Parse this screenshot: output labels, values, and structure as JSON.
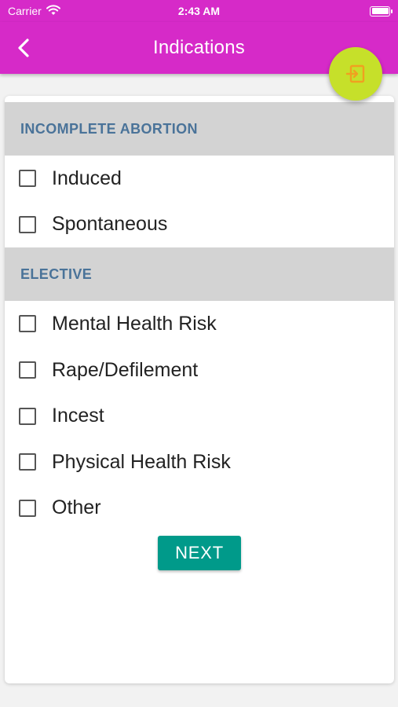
{
  "status_bar": {
    "carrier": "Carrier",
    "time": "2:43 AM",
    "icons": [
      "wifi-icon",
      "battery-icon"
    ]
  },
  "app_bar": {
    "title": "Indications",
    "back_icon": "chevron-left-icon",
    "color": "#d62ac8"
  },
  "fab": {
    "icon": "exit-to-app-icon",
    "color": "#c6e02a",
    "icon_color": "#f0a020"
  },
  "sections": [
    {
      "title": "INCOMPLETE ABORTION",
      "options": [
        {
          "label": "Induced",
          "checked": false
        },
        {
          "label": "Spontaneous",
          "checked": false
        }
      ]
    },
    {
      "title": "ELECTIVE",
      "options": [
        {
          "label": "Mental Health Risk",
          "checked": false
        },
        {
          "label": "Rape/Defilement",
          "checked": false
        },
        {
          "label": "Incest",
          "checked": false
        },
        {
          "label": "Physical Health Risk",
          "checked": false
        },
        {
          "label": "Other",
          "checked": false
        }
      ]
    }
  ],
  "next_button": {
    "label": "NEXT",
    "color": "#009a8a"
  }
}
